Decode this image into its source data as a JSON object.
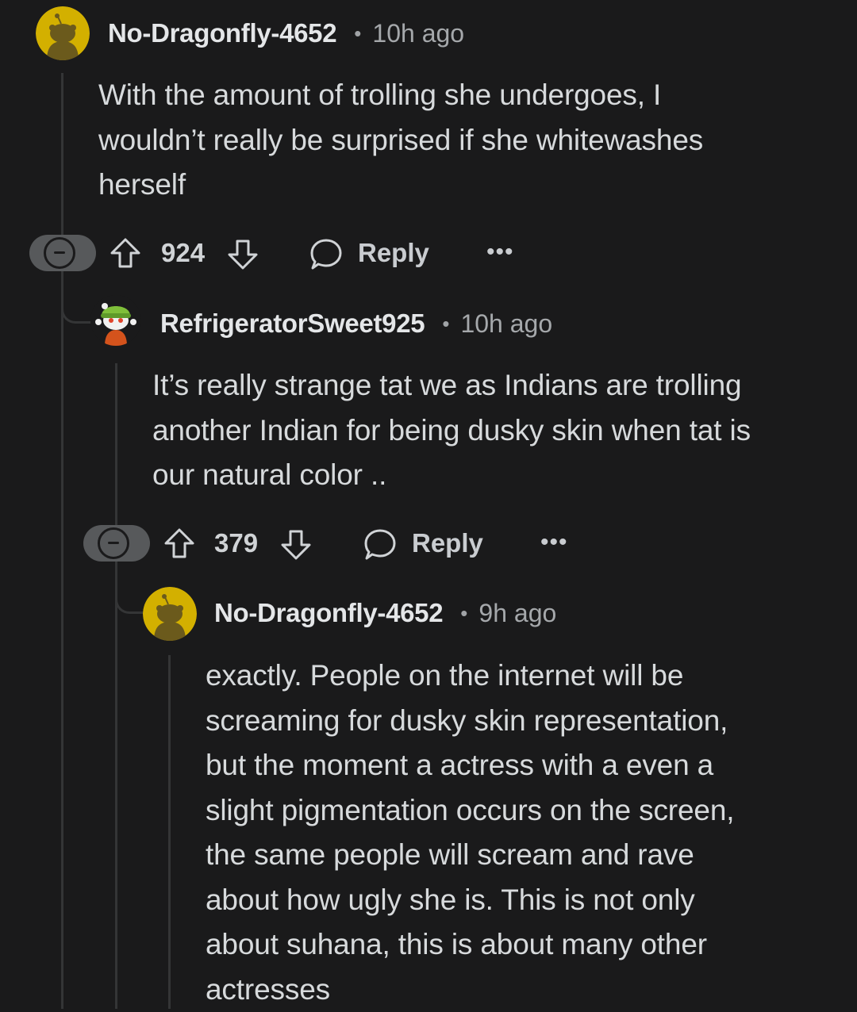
{
  "comments": [
    {
      "username": "No-Dragonfly-4652",
      "separator": "•",
      "time": "10h ago",
      "avatar": "snoo-avatar-gold",
      "lines": [
        "With the amount of trolling she undergoes, I",
        "wouldn’t really be surprised if she whitewashes",
        "herself"
      ],
      "votes": "924",
      "reply_label": "Reply",
      "more_label": "•••"
    },
    {
      "username": "RefrigeratorSweet925",
      "separator": "•",
      "time": "10h ago",
      "avatar": "snoo-avatar-green-beanie",
      "lines": [
        "It’s really strange tat we as Indians are trolling",
        "another Indian for being dusky skin when tat is",
        "our natural color .."
      ],
      "votes": "379",
      "reply_label": "Reply",
      "more_label": "•••"
    },
    {
      "username": "No-Dragonfly-4652",
      "separator": "•",
      "time": "9h ago",
      "avatar": "snoo-avatar-gold",
      "lines": [
        "exactly. People on the internet will be",
        "screaming for dusky skin representation,",
        "but the moment a actress with a even a",
        "slight pigmentation occurs on the screen,",
        "the same people will scream and rave",
        "about how ugly she is. This is not only",
        "about suhana, this is about many other",
        "actresses"
      ]
    }
  ],
  "colors": {
    "background": "#1a1a1b",
    "thread_line": "#343536",
    "avatar_gold": "#d3b000",
    "text": "#d7dadc"
  }
}
